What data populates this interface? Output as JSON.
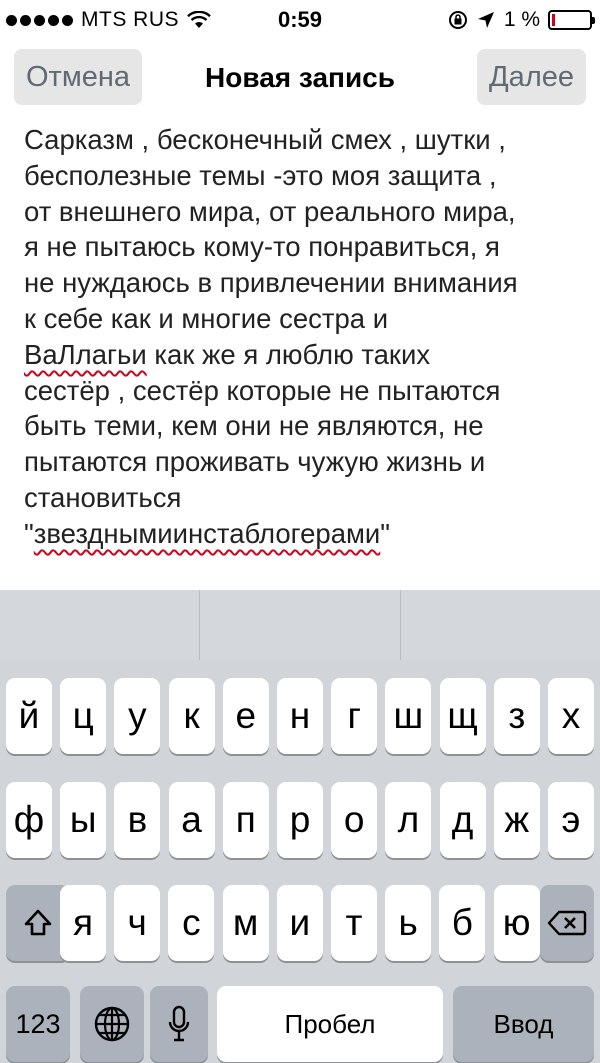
{
  "status": {
    "carrier": "MTS RUS",
    "time": "0:59",
    "battery": "1 %",
    "battery_level": 0.01
  },
  "nav": {
    "cancel_label": "Отмена",
    "title": "Новая запись",
    "next_label": "Далее"
  },
  "editor": {
    "text_segments": [
      "Сарказм , бесконечный смех , шутки ,\nбесполезные темы -это моя защита ,\nот внешнего мира, от реального мира,\nя не пытаюсь кому-то понравиться, я\nне нуждаюсь в привлечении внимания\nк себе как и многие сестра и\n",
      "ВаЛлагьи",
      " как же я люблю таких\nсестёр , сестёр которые не пытаются\nбыть теми, кем они не являются, не\nпытаются проживать чужую жизнь и\nстановиться\n\"",
      "звезднымиинстаблогерами",
      "\""
    ]
  },
  "keyboard": {
    "row1": [
      "й",
      "ц",
      "у",
      "к",
      "е",
      "н",
      "г",
      "ш",
      "щ",
      "з",
      "х"
    ],
    "row2": [
      "ф",
      "ы",
      "в",
      "а",
      "п",
      "р",
      "о",
      "л",
      "д",
      "ж",
      "э"
    ],
    "row3": [
      "я",
      "ч",
      "с",
      "м",
      "и",
      "т",
      "ь",
      "б",
      "ю"
    ],
    "numbers_label": "123",
    "space_label": "Пробел",
    "return_label": "Ввод"
  }
}
